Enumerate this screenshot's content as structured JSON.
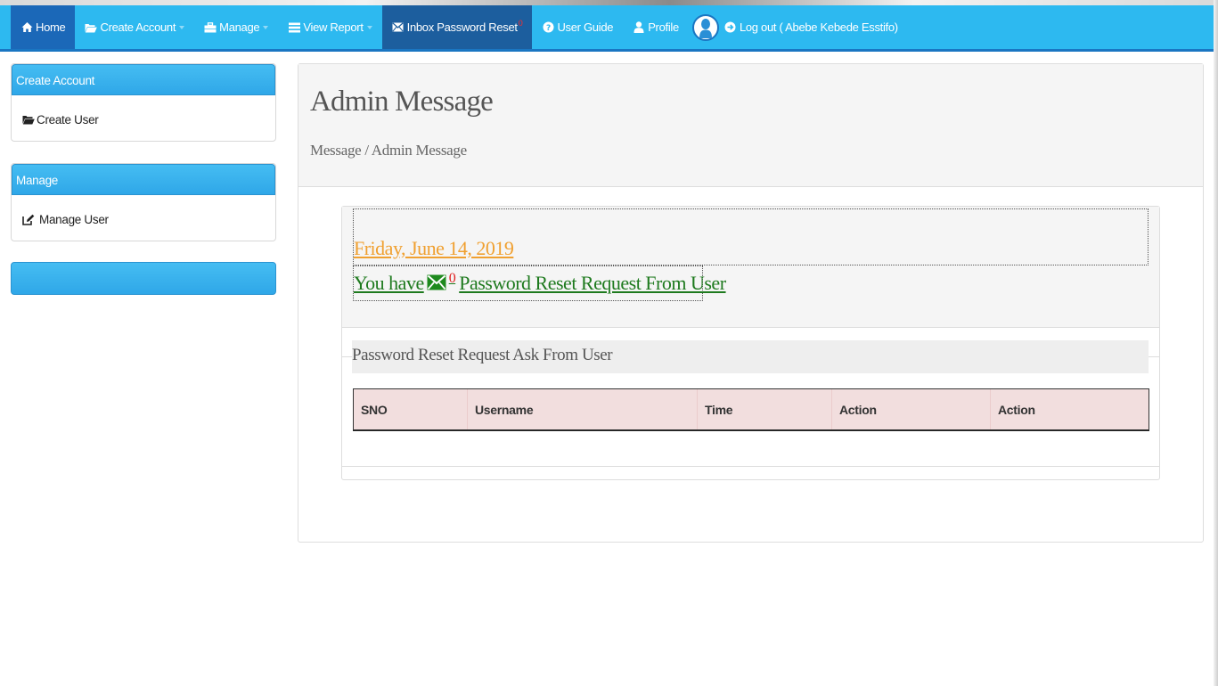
{
  "nav": {
    "home": "Home",
    "create_account": "Create Account",
    "manage": "Manage",
    "view_report": "View Report",
    "inbox": "Inbox Password Reset",
    "inbox_count": "0",
    "user_guide": "User Guide",
    "profile": "Profile",
    "logout": "Log out ( Abebe Kebede Esstifo)"
  },
  "sidebar": {
    "panels": [
      {
        "heading": "Create Account",
        "item": "Create User"
      },
      {
        "heading": "Manage",
        "item": "Manage User"
      }
    ]
  },
  "main": {
    "title": "Admin Message",
    "breadcrumb": "Message / Admin Message",
    "date": "Friday, June 14, 2019",
    "message_prefix": "You have",
    "message_count": "0",
    "message_suffix": "Password Reset Request From User",
    "section_title": "Password Reset Request Ask From User",
    "table": {
      "columns": [
        "SNO",
        "Username",
        "Time",
        "Action",
        "Action"
      ]
    }
  },
  "colors": {
    "nav_bg": "#2db9f0",
    "nav_active": "#1b68b8",
    "date_link": "#f0a030",
    "message_link": "#1e7a1e",
    "table_header_bg": "#f2dede"
  }
}
